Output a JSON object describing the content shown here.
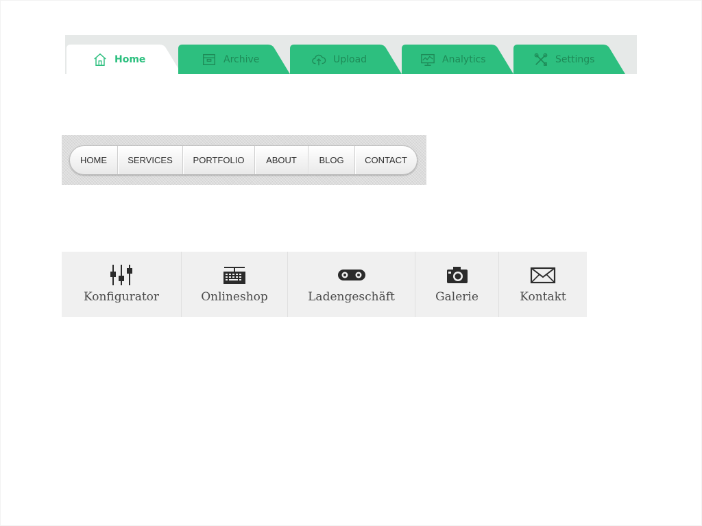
{
  "tab_menu": {
    "accent_color": "#2dbf7f",
    "tabs": [
      {
        "label": "Home",
        "icon": "home-icon",
        "active": true
      },
      {
        "label": "Archive",
        "icon": "archive-icon",
        "active": false
      },
      {
        "label": "Upload",
        "icon": "cloud-upload-icon",
        "active": false
      },
      {
        "label": "Analytics",
        "icon": "analytics-icon",
        "active": false
      },
      {
        "label": "Settings",
        "icon": "settings-tools-icon",
        "active": false
      }
    ]
  },
  "pill_menu": {
    "items": [
      "HOME",
      "SERVICES",
      "PORTFOLIO",
      "ABOUT",
      "BLOG",
      "CONTACT"
    ]
  },
  "icon_menu": {
    "items": [
      {
        "label": "Konfigurator",
        "icon": "sliders-icon"
      },
      {
        "label": "Onlineshop",
        "icon": "keyboard-icon"
      },
      {
        "label": "Ladengeschäft",
        "icon": "bike-chain-icon"
      },
      {
        "label": "Galerie",
        "icon": "camera-icon"
      },
      {
        "label": "Kontakt",
        "icon": "envelope-icon"
      }
    ]
  }
}
